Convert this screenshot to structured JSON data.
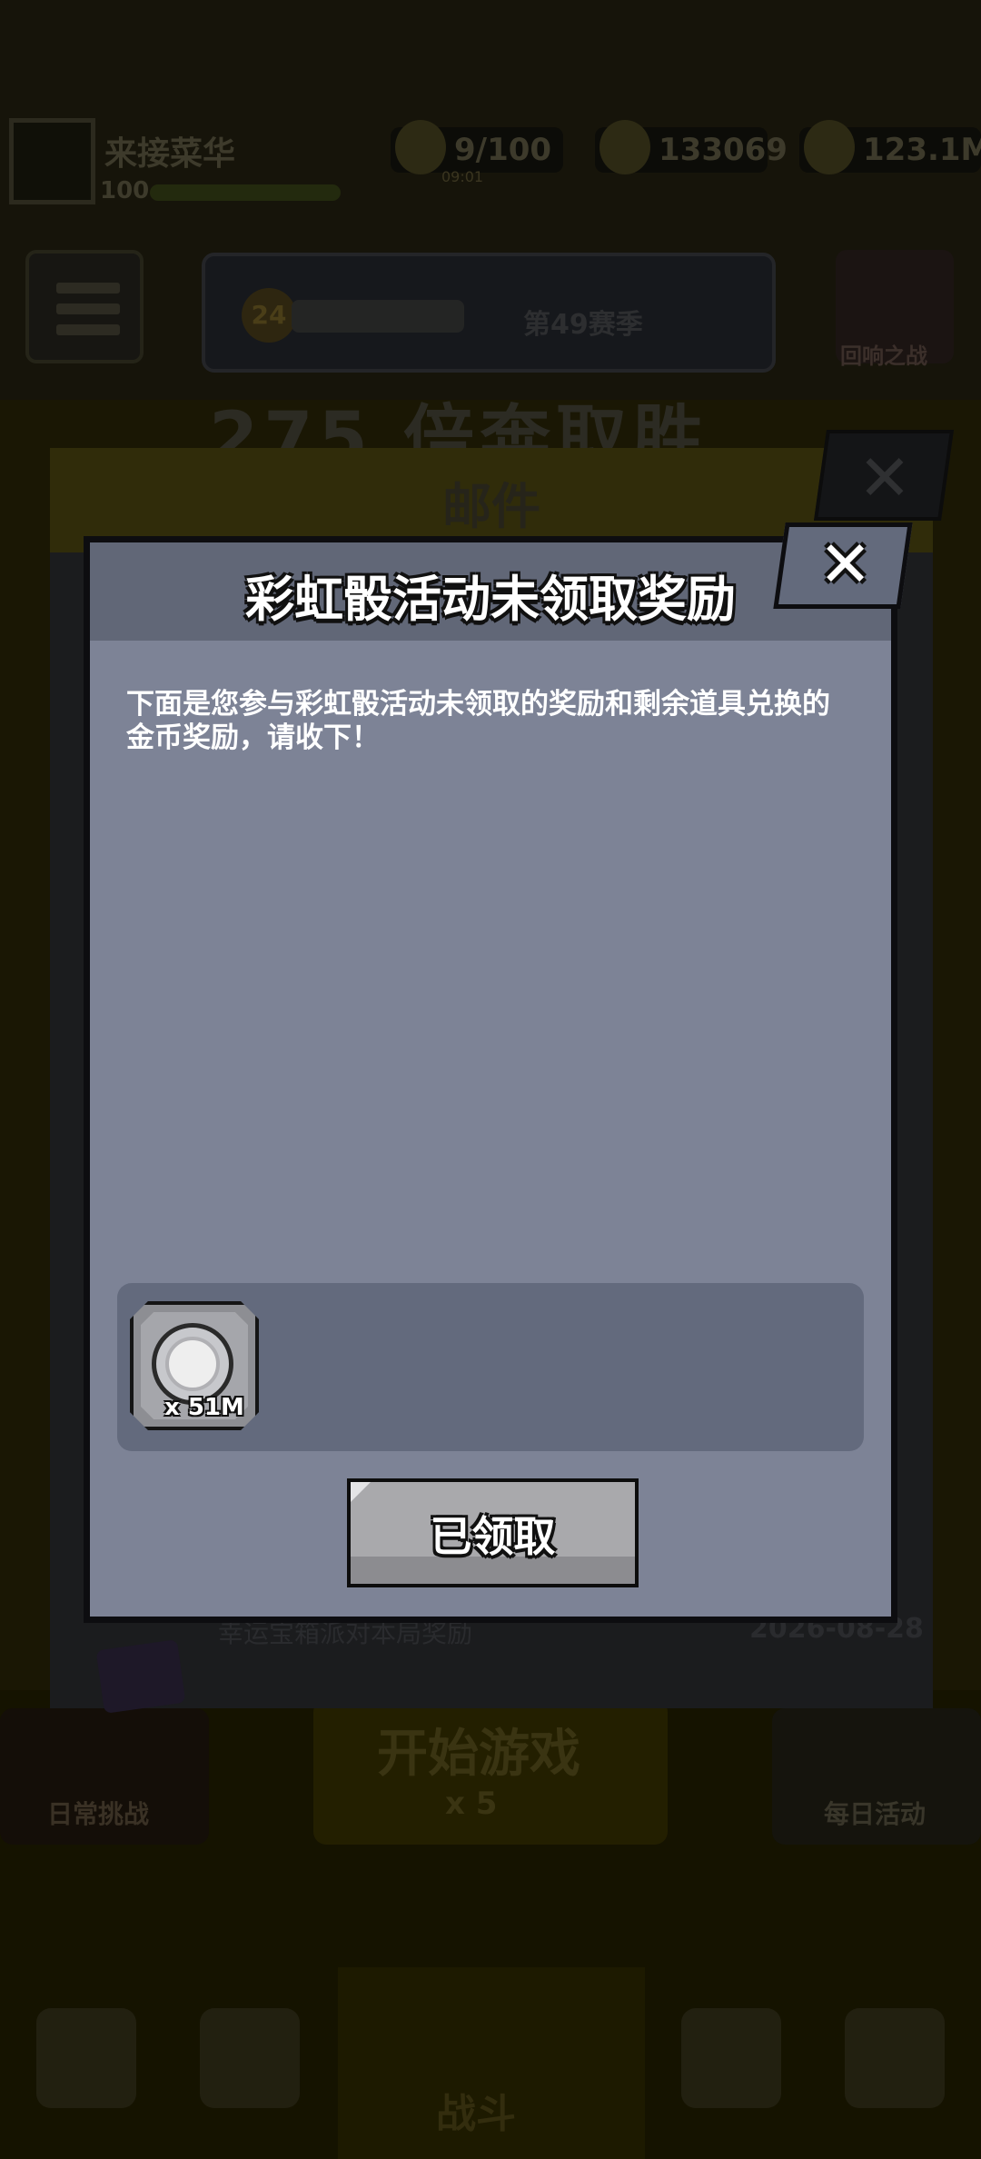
{
  "background": {
    "player": {
      "name": "来接菜华",
      "level": "100"
    },
    "resources": {
      "energy": "9/100",
      "energy_timer": "09:01",
      "gems": "133069",
      "coins": "123.1M"
    },
    "season": {
      "badge": "24",
      "text": "第49赛季"
    },
    "shield_label": "回响之战",
    "big_title": "275 倍奔取胜",
    "bottom": {
      "left_label": "日常挑战",
      "start_label": "开始游戏",
      "start_sub": "x 5",
      "right_label": "每日活动",
      "battle_label": "战斗"
    }
  },
  "mail": {
    "title": "邮件",
    "close_icon": "close-icon",
    "last_row": {
      "text": "幸运宝箱派对本局奖励",
      "date": "2026-08-28"
    }
  },
  "dialog": {
    "title": "彩虹骰活动未领取奖励",
    "close_icon": "close-icon",
    "body": "下面是您参与彩虹骰活动未领取的奖励和剩余道具兑换的金币奖励，请收下！",
    "reward": {
      "icon": "silver-coin-icon",
      "quantity": "x 51M"
    },
    "claim_button": "已领取"
  },
  "colors": {
    "dialog_bg": "#7d8396",
    "dialog_header": "#616777",
    "reward_area": "#636a7d",
    "button_disabled": "#a9a9ac"
  }
}
